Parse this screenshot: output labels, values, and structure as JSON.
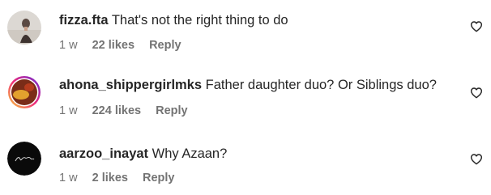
{
  "comments": [
    {
      "username": "fizza.fta",
      "text": "That's not the right thing to do",
      "time": "1 w",
      "likes": "22 likes",
      "reply": "Reply",
      "like_icon": "heart-outline-icon",
      "avatar_colors": [
        "#d9d5d0",
        "#5a4a44"
      ]
    },
    {
      "username": "ahona_shippergirlmks",
      "text": "Father daughter duo? Or Siblings duo?",
      "time": "1 w",
      "likes": "224 likes",
      "reply": "Reply",
      "like_icon": "heart-outline-icon",
      "avatar_colors": [
        "#e7a42a",
        "#c3165c",
        "#6b2f1d"
      ]
    },
    {
      "username": "aarzoo_inayat",
      "text": "Why Azaan?",
      "time": "1 w",
      "likes": "2 likes",
      "reply": "Reply",
      "like_icon": "heart-outline-icon",
      "avatar_colors": [
        "#0a0a0a",
        "#e6e6e6"
      ]
    }
  ]
}
